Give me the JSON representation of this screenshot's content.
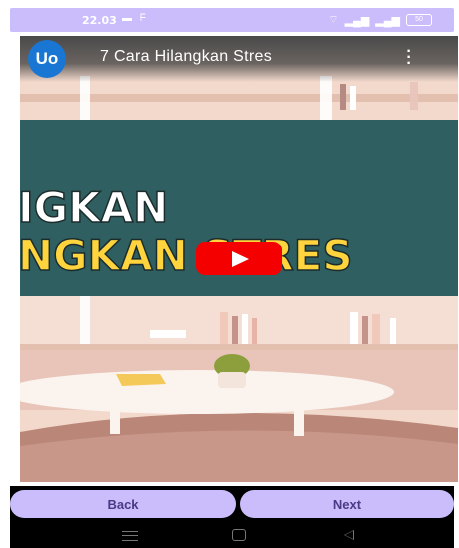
{
  "status_bar": {
    "time": "22.03",
    "battery": "50",
    "icons": [
      "message-icon",
      "notification-icon",
      "wifi-icon",
      "signal-icon",
      "battery-icon"
    ]
  },
  "video": {
    "channel_avatar": "Uo",
    "title": "7 Cara Hilangkan Stres",
    "thumbnail_line1": "IGKAN",
    "thumbnail_line2": "NGKAN STRES",
    "colors": {
      "banner": "#2f5f60",
      "text_white": "#ffffff",
      "text_yellow": "#ffd43d",
      "play": "#f40000"
    }
  },
  "buttons": {
    "back_label": "Back",
    "next_label": "Next",
    "color": "#cbbcfc"
  }
}
